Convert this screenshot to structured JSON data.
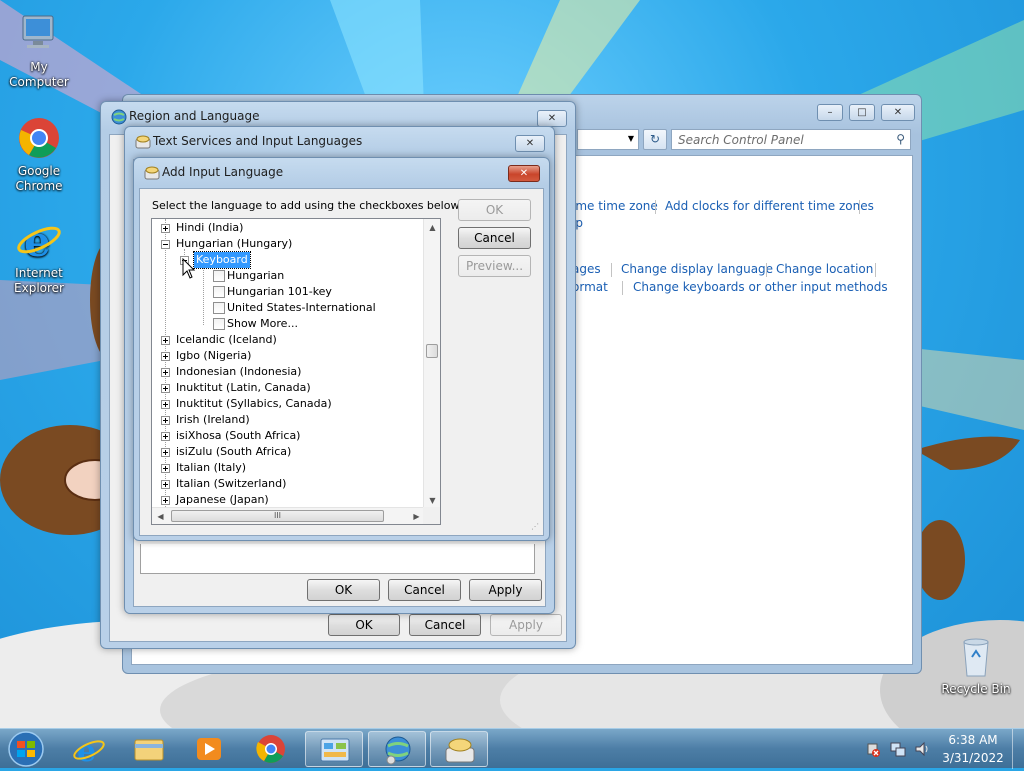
{
  "desktop": {
    "icons": [
      {
        "label": "My Computer",
        "icon": "computer-icon"
      },
      {
        "label": "Google Chrome",
        "icon": "chrome-icon"
      },
      {
        "label": "Internet Explorer",
        "icon": "ie-icon"
      },
      {
        "label": "Recycle Bin",
        "icon": "recycle-bin-icon"
      }
    ]
  },
  "control_panel": {
    "search_placeholder": "Search Control Panel",
    "links": {
      "time_zone": "ime time zone",
      "add_clocks": "Add clocks for different time zones",
      "help_fragment": "lp",
      "languages_fragment": "ages",
      "change_display_language": "Change display language",
      "change_location": "Change location",
      "format_fragment": "ormat",
      "change_keyboards": "Change keyboards or other input methods"
    }
  },
  "region_dialog": {
    "title": "Region and Language",
    "buttons": {
      "ok": "OK",
      "cancel": "Cancel",
      "apply": "Apply"
    }
  },
  "text_services_dialog": {
    "title": "Text Services and Input Languages",
    "buttons": {
      "ok": "OK",
      "cancel": "Cancel",
      "apply": "Apply"
    }
  },
  "add_input_dialog": {
    "title": "Add Input Language",
    "instruction": "Select the language to add using the checkboxes below.",
    "buttons": {
      "ok": "OK",
      "cancel": "Cancel",
      "preview": "Preview..."
    },
    "tree": {
      "hindi": "Hindi (India)",
      "hungarian": "Hungarian (Hungary)",
      "keyboard": "Keyboard",
      "kb_hungarian": "Hungarian",
      "kb_hungarian_101": "Hungarian 101-key",
      "kb_us_international": "United States-International",
      "show_more": "Show More...",
      "icelandic": "Icelandic (Iceland)",
      "igbo": "Igbo (Nigeria)",
      "indonesian": "Indonesian (Indonesia)",
      "inuktitut_latin": "Inuktitut (Latin, Canada)",
      "inuktitut_syllabics": "Inuktitut (Syllabics, Canada)",
      "irish": "Irish (Ireland)",
      "isixhosa": "isiXhosa (South Africa)",
      "isizulu": "isiZulu (South Africa)",
      "italian_italy": "Italian (Italy)",
      "italian_switzerland": "Italian (Switzerland)",
      "japanese": "Japanese (Japan)"
    },
    "hscroll_grip": "III"
  },
  "taskbar": {
    "time": "6:38 AM",
    "date": "3/31/2022"
  }
}
